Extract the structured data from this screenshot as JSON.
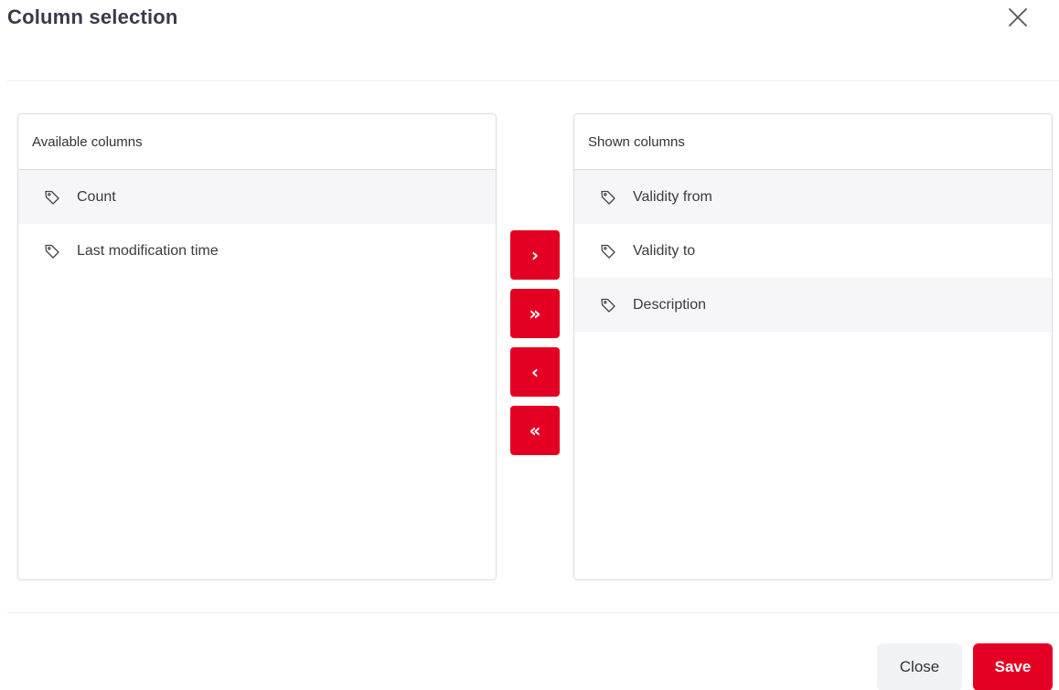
{
  "dialog": {
    "title": "Column selection"
  },
  "available": {
    "header": "Available columns",
    "items": [
      {
        "label": "Count"
      },
      {
        "label": "Last modification time"
      }
    ]
  },
  "shown": {
    "header": "Shown columns",
    "items": [
      {
        "label": "Validity from"
      },
      {
        "label": "Validity to"
      },
      {
        "label": "Description"
      }
    ]
  },
  "transfer": {
    "move_right": "›",
    "move_all_right": "»",
    "move_left": "‹",
    "move_all_left": "«"
  },
  "footer": {
    "close_label": "Close",
    "save_label": "Save"
  },
  "colors": {
    "accent": "#e30022",
    "panel_border": "#dcdce0",
    "alt_row": "#f6f6f8",
    "secondary_button": "#f0f2f5"
  },
  "icons": {
    "close": "close-icon",
    "tag": "tag-icon"
  }
}
